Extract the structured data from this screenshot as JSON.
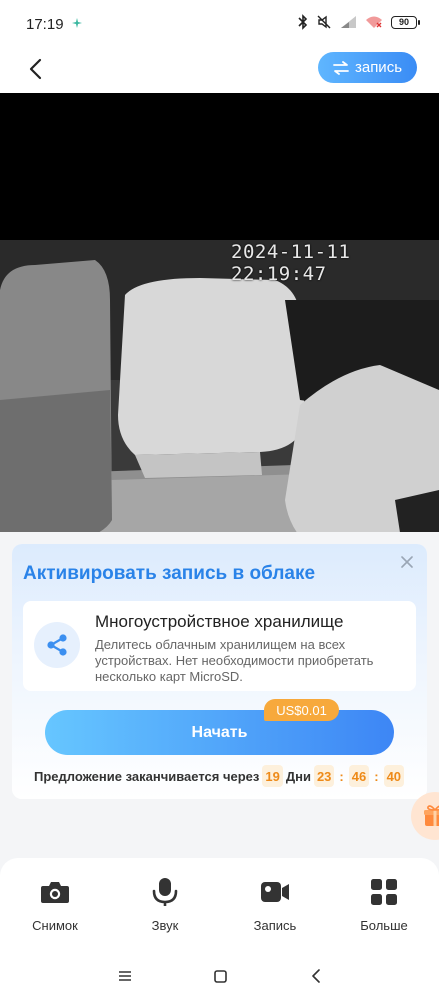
{
  "status_bar": {
    "time": "17:19",
    "battery": "90",
    "icons": [
      "bluetooth-icon",
      "mute-icon",
      "signal-icon",
      "wifi-icon",
      "battery-icon"
    ]
  },
  "header": {
    "back_icon": "chevron-left-icon",
    "record_label": "запись",
    "record_icon": "swap-arrows-icon"
  },
  "camera": {
    "timestamp": "2024-11-11 22:19:47"
  },
  "cloud_card": {
    "title": "Активировать запись в облаке",
    "close_icon": "close-icon",
    "feature": {
      "icon": "share-icon",
      "title": "Многоустройствное хранилище",
      "description": "Делитесь облачным хранилищем на всех устройствах. Нет необходимости приобретать несколько карт MicroSD."
    },
    "price": "US$0.01",
    "start_label": "Начать",
    "offer": {
      "prefix": "Предложение заканчивается через",
      "days": "19",
      "days_label": "Дни",
      "hours": "23",
      "minutes": "46",
      "seconds": "40",
      "separator": ":"
    }
  },
  "toolbar": {
    "items": [
      {
        "label": "Снимок",
        "icon": "camera-icon"
      },
      {
        "label": "Звук",
        "icon": "microphone-icon"
      },
      {
        "label": "Запись",
        "icon": "video-icon"
      },
      {
        "label": "Больше",
        "icon": "grid-icon"
      }
    ]
  },
  "colors": {
    "accent": "#2a83e8",
    "button_gradient_start": "#66c6ff",
    "button_gradient_end": "#3d86f5",
    "badge": "#f7a93c",
    "timer": "#ee8a18"
  }
}
